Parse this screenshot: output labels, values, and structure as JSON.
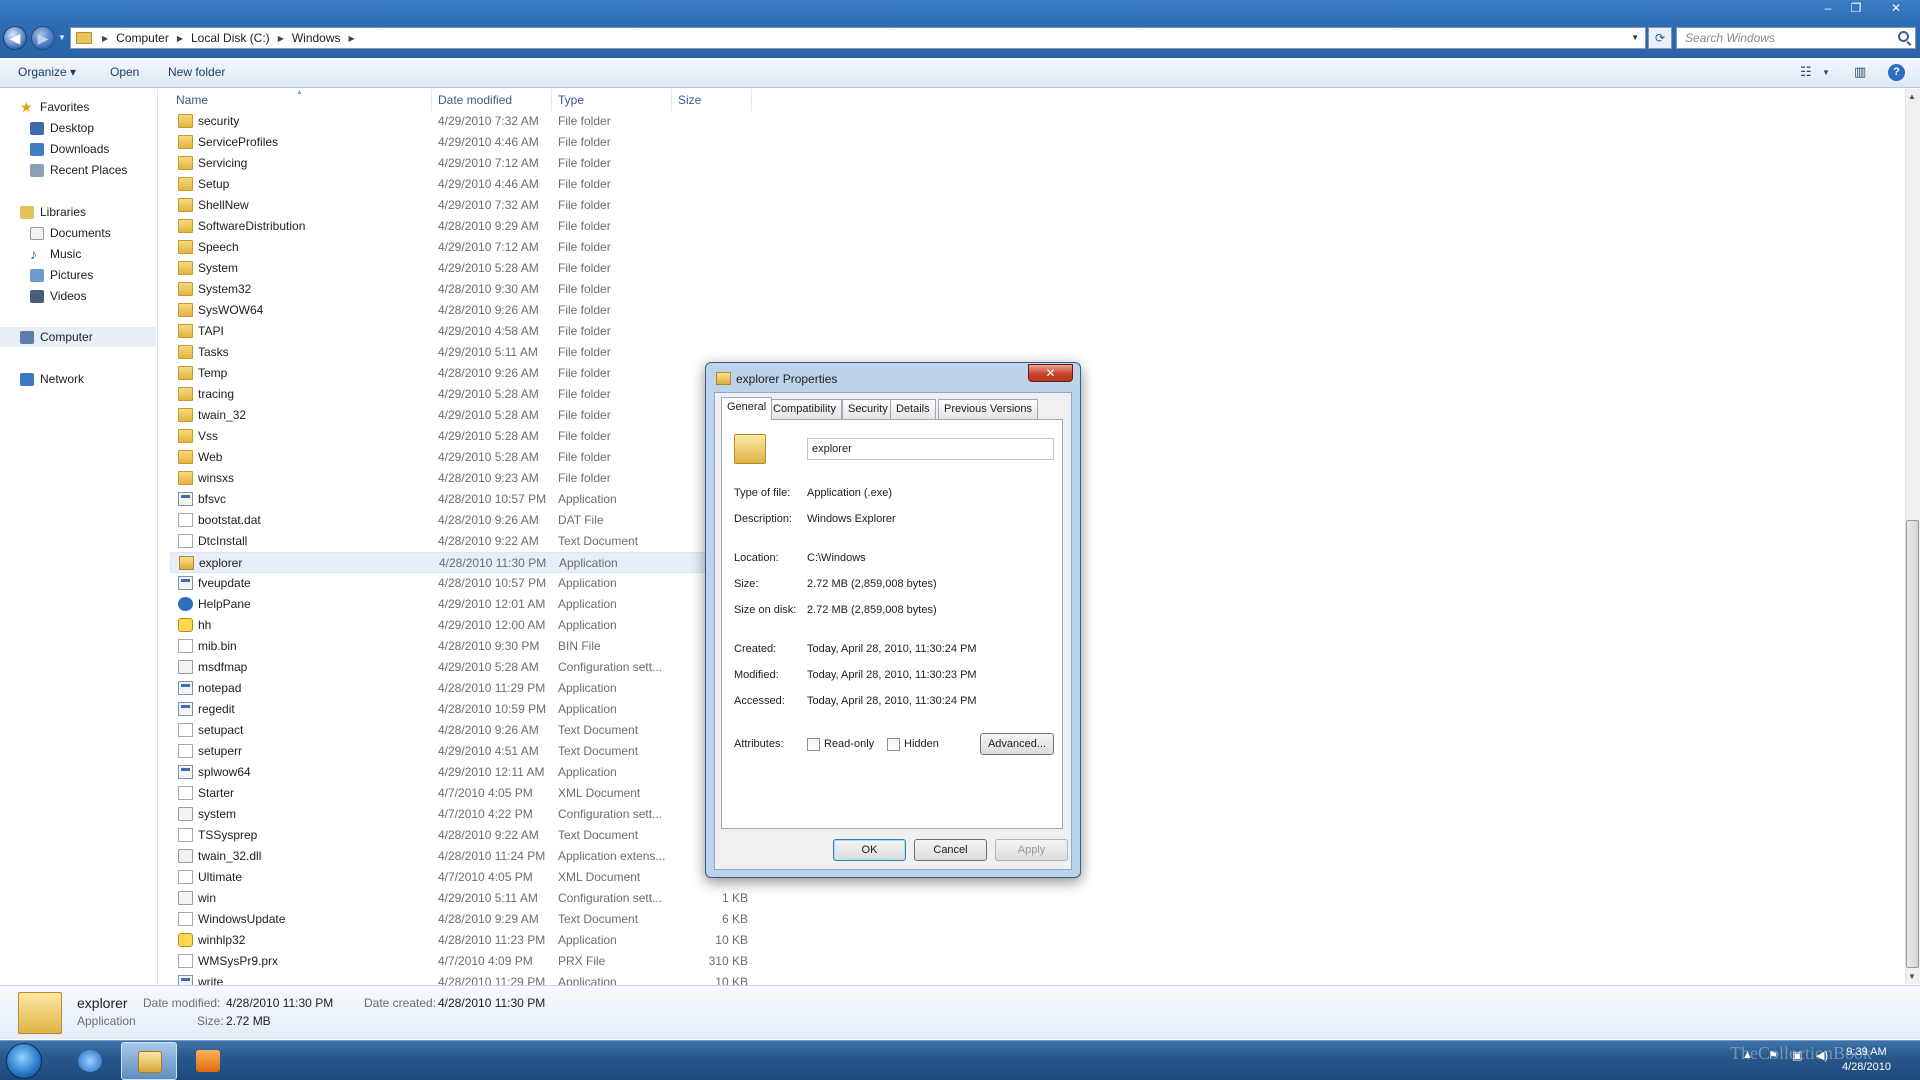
{
  "window": {
    "controls": {
      "minimize": "–",
      "maximize": "❐",
      "close": "✕"
    }
  },
  "address": {
    "crumbs": [
      "Computer",
      "Local Disk (C:)",
      "Windows"
    ],
    "search_placeholder": "Search Windows"
  },
  "toolbar": {
    "organize": "Organize ▾",
    "open": "Open",
    "new_folder": "New folder"
  },
  "nav": {
    "favorites": "Favorites",
    "desktop": "Desktop",
    "downloads": "Downloads",
    "recent_places": "Recent Places",
    "libraries": "Libraries",
    "documents": "Documents",
    "music": "Music",
    "pictures": "Pictures",
    "videos": "Videos",
    "computer": "Computer",
    "network": "Network"
  },
  "columns": {
    "name": "Name",
    "date": "Date modified",
    "type": "Type",
    "size": "Size"
  },
  "files": [
    {
      "name": "security",
      "date": "4/29/2010 7:32 AM",
      "type": "File folder",
      "size": "",
      "icon": "folder"
    },
    {
      "name": "ServiceProfiles",
      "date": "4/29/2010 4:46 AM",
      "type": "File folder",
      "size": "",
      "icon": "folder"
    },
    {
      "name": "Servicing",
      "date": "4/29/2010 7:12 AM",
      "type": "File folder",
      "size": "",
      "icon": "folder"
    },
    {
      "name": "Setup",
      "date": "4/29/2010 4:46 AM",
      "type": "File folder",
      "size": "",
      "icon": "folder"
    },
    {
      "name": "ShellNew",
      "date": "4/29/2010 7:32 AM",
      "type": "File folder",
      "size": "",
      "icon": "folder"
    },
    {
      "name": "SoftwareDistribution",
      "date": "4/28/2010 9:29 AM",
      "type": "File folder",
      "size": "",
      "icon": "folder"
    },
    {
      "name": "Speech",
      "date": "4/29/2010 7:12 AM",
      "type": "File folder",
      "size": "",
      "icon": "folder"
    },
    {
      "name": "System",
      "date": "4/29/2010 5:28 AM",
      "type": "File folder",
      "size": "",
      "icon": "folder"
    },
    {
      "name": "System32",
      "date": "4/28/2010 9:30 AM",
      "type": "File folder",
      "size": "",
      "icon": "folder"
    },
    {
      "name": "SysWOW64",
      "date": "4/28/2010 9:26 AM",
      "type": "File folder",
      "size": "",
      "icon": "folder"
    },
    {
      "name": "TAPI",
      "date": "4/29/2010 4:58 AM",
      "type": "File folder",
      "size": "",
      "icon": "folder"
    },
    {
      "name": "Tasks",
      "date": "4/29/2010 5:11 AM",
      "type": "File folder",
      "size": "",
      "icon": "folder"
    },
    {
      "name": "Temp",
      "date": "4/28/2010 9:26 AM",
      "type": "File folder",
      "size": "",
      "icon": "folder"
    },
    {
      "name": "tracing",
      "date": "4/29/2010 5:28 AM",
      "type": "File folder",
      "size": "",
      "icon": "folder"
    },
    {
      "name": "twain_32",
      "date": "4/29/2010 5:28 AM",
      "type": "File folder",
      "size": "",
      "icon": "folder"
    },
    {
      "name": "Vss",
      "date": "4/29/2010 5:28 AM",
      "type": "File folder",
      "size": "",
      "icon": "folder"
    },
    {
      "name": "Web",
      "date": "4/29/2010 5:28 AM",
      "type": "File folder",
      "size": "",
      "icon": "folder"
    },
    {
      "name": "winsxs",
      "date": "4/28/2010 9:23 AM",
      "type": "File folder",
      "size": "",
      "icon": "folder"
    },
    {
      "name": "bfsvc",
      "date": "4/28/2010 10:57 PM",
      "type": "Application",
      "size": "",
      "icon": "app"
    },
    {
      "name": "bootstat.dat",
      "date": "4/28/2010 9:26 AM",
      "type": "DAT File",
      "size": "",
      "icon": "doc"
    },
    {
      "name": "DtcInstall",
      "date": "4/28/2010 9:22 AM",
      "type": "Text Document",
      "size": "",
      "icon": "doc"
    },
    {
      "name": "explorer",
      "date": "4/28/2010 11:30 PM",
      "type": "Application",
      "size": "2",
      "icon": "explorer",
      "selected": true
    },
    {
      "name": "fveupdate",
      "date": "4/28/2010 10:57 PM",
      "type": "Application",
      "size": "",
      "icon": "app"
    },
    {
      "name": "HelpPane",
      "date": "4/29/2010 12:01 AM",
      "type": "Application",
      "size": "",
      "icon": "help"
    },
    {
      "name": "hh",
      "date": "4/29/2010 12:00 AM",
      "type": "Application",
      "size": "",
      "icon": "q"
    },
    {
      "name": "mib.bin",
      "date": "4/28/2010 9:30 PM",
      "type": "BIN File",
      "size": "",
      "icon": "doc"
    },
    {
      "name": "msdfmap",
      "date": "4/29/2010 5:28 AM",
      "type": "Configuration sett...",
      "size": "",
      "icon": "cfg"
    },
    {
      "name": "notepad",
      "date": "4/28/2010 11:29 PM",
      "type": "Application",
      "size": "",
      "icon": "app"
    },
    {
      "name": "regedit",
      "date": "4/28/2010 10:59 PM",
      "type": "Application",
      "size": "",
      "icon": "app"
    },
    {
      "name": "setupact",
      "date": "4/28/2010 9:26 AM",
      "type": "Text Document",
      "size": "",
      "icon": "doc"
    },
    {
      "name": "setuperr",
      "date": "4/29/2010 4:51 AM",
      "type": "Text Document",
      "size": "",
      "icon": "doc"
    },
    {
      "name": "splwow64",
      "date": "4/29/2010 12:11 AM",
      "type": "Application",
      "size": "",
      "icon": "app"
    },
    {
      "name": "Starter",
      "date": "4/7/2010 4:05 PM",
      "type": "XML Document",
      "size": "",
      "icon": "doc"
    },
    {
      "name": "system",
      "date": "4/7/2010 4:22 PM",
      "type": "Configuration sett...",
      "size": "",
      "icon": "cfg"
    },
    {
      "name": "TSSysprep",
      "date": "4/28/2010 9:22 AM",
      "type": "Text Document",
      "size": "",
      "icon": "doc"
    },
    {
      "name": "twain_32.dll",
      "date": "4/28/2010 11:24 PM",
      "type": "Application extens...",
      "size": "",
      "icon": "cfg"
    },
    {
      "name": "Ultimate",
      "date": "4/7/2010 4:05 PM",
      "type": "XML Document",
      "size": "",
      "icon": "doc"
    },
    {
      "name": "win",
      "date": "4/29/2010 5:11 AM",
      "type": "Configuration sett...",
      "size": "1 KB",
      "icon": "cfg"
    },
    {
      "name": "WindowsUpdate",
      "date": "4/28/2010 9:29 AM",
      "type": "Text Document",
      "size": "6 KB",
      "icon": "doc"
    },
    {
      "name": "winhlp32",
      "date": "4/28/2010 11:23 PM",
      "type": "Application",
      "size": "10 KB",
      "icon": "q"
    },
    {
      "name": "WMSysPr9.prx",
      "date": "4/7/2010 4:09 PM",
      "type": "PRX File",
      "size": "310 KB",
      "icon": "doc"
    },
    {
      "name": "write",
      "date": "4/28/2010 11:29 PM",
      "type": "Application",
      "size": "10 KB",
      "icon": "app"
    }
  ],
  "details_pane": {
    "name": "explorer",
    "type": "Application",
    "date_modified_label": "Date modified:",
    "date_modified": "4/28/2010 11:30 PM",
    "size_label": "Size:",
    "size": "2.72 MB",
    "date_created_label": "Date created:",
    "date_created": "4/28/2010 11:30 PM"
  },
  "dialog": {
    "title": "explorer Properties",
    "close": "✕",
    "tabs": [
      "General",
      "Compatibility",
      "Security",
      "Details",
      "Previous Versions"
    ],
    "file_name": "explorer",
    "type_label": "Type of file:",
    "type_value": "Application (.exe)",
    "desc_label": "Description:",
    "desc_value": "Windows Explorer",
    "location_label": "Location:",
    "location_value": "C:\\Windows",
    "size_label": "Size:",
    "size_value": "2.72 MB (2,859,008 bytes)",
    "sizeondisk_label": "Size on disk:",
    "sizeondisk_value": "2.72 MB (2,859,008 bytes)",
    "created_label": "Created:",
    "created_value": "Today, April 28, 2010, 11:30:24 PM",
    "modified_label": "Modified:",
    "modified_value": "Today, April 28, 2010, 11:30:23 PM",
    "accessed_label": "Accessed:",
    "accessed_value": "Today, April 28, 2010, 11:30:24 PM",
    "attributes_label": "Attributes:",
    "readonly_label": "Read-only",
    "hidden_label": "Hidden",
    "advanced_label": "Advanced...",
    "ok_label": "OK",
    "cancel_label": "Cancel",
    "apply_label": "Apply"
  },
  "taskbar": {
    "clock_time": "9:39 AM",
    "clock_date": "4/28/2010",
    "watermark": "TheCollectionBook"
  }
}
